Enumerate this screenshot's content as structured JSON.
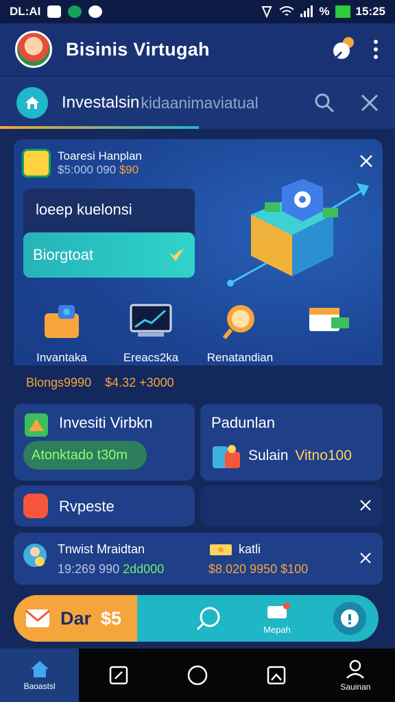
{
  "status_bar": {
    "carrier": "DL:AI",
    "time": "15:25",
    "battery": "%"
  },
  "header": {
    "title": "Bisinis Virtugah",
    "avatar": "avatar-icon",
    "notification_icon": "pin-icon",
    "menu_icon": "more-vert-icon"
  },
  "search": {
    "title": "Investalsin",
    "placeholder": "kidaanimaviatual"
  },
  "hero": {
    "label": "Toaresi Hanplan",
    "price_prefix": "$5:000 090",
    "price_accent": "$90",
    "promo_heading": "loeep kuelonsi",
    "promo_button": "Biorgtoat",
    "features": [
      {
        "label": "Invantaka",
        "value": "Blongs9990",
        "icon": "wallet-icon"
      },
      {
        "label": "Ereacs2ka",
        "value": "$4.32 +3000",
        "icon": "chart-monitor-icon"
      },
      {
        "label": "Renatandian",
        "value": "",
        "icon": "magnifier-icon"
      }
    ]
  },
  "panels": {
    "invest": {
      "title": "Invesiti Virbkn",
      "pill": "Atonktado t30m"
    },
    "pad": {
      "title": "Padunlan",
      "line_label": "Sulain",
      "line_value": "Vitno100"
    },
    "rv": {
      "title": "Rvpeste"
    },
    "tx": {
      "left_title": "Tnwist Mraidtan",
      "left_value_a": "19:269 990",
      "left_value_b": "2dd000",
      "right_title": "katli",
      "right_value": "$8.020 9950 $100"
    }
  },
  "action_bar": {
    "label": "Dar",
    "amount": "$5",
    "mid_label": "Mepah"
  },
  "nav": [
    {
      "label": "Baoastsl",
      "icon": "home-icon",
      "active": true
    },
    {
      "label": "",
      "icon": "doc-icon",
      "active": false
    },
    {
      "label": "",
      "icon": "circle-icon",
      "active": false
    },
    {
      "label": "",
      "icon": "square-icon",
      "active": false
    },
    {
      "label": "Sauinan",
      "icon": "user-icon",
      "active": false
    }
  ],
  "colors": {
    "accent_orange": "#f6a53d",
    "accent_cyan": "#1fb6c5",
    "success_green": "#6ff06b"
  }
}
